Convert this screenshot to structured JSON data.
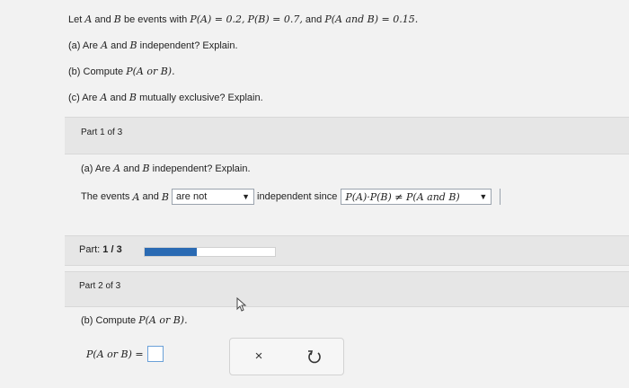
{
  "problem": {
    "intro": "Let",
    "A": "A",
    "and": "and",
    "B": "B",
    "be_events": "be events with",
    "pa": "P(A) = 0.2,",
    "pb": "P(B) = 0.7,",
    "and2": "and",
    "pab": "P(A and B) = 0.15.",
    "qa_prefix": "(a) Are",
    "qa_suffix": "independent? Explain.",
    "qb_prefix": "(b) Compute",
    "qb_expr": "P(A or B).",
    "qc_prefix": "(c) Are",
    "qc_suffix": "mutually exclusive? Explain."
  },
  "part1": {
    "title": "Part 1 of 3",
    "question_prefix": "(a) Are",
    "question_suffix": "independent? Explain.",
    "answer_prefix": "The events",
    "answer_and": "and",
    "select1_value": "are not",
    "answer_mid": "independent since",
    "select2_value": "P(A)·P(B) ≠ P(A and B)"
  },
  "progress": {
    "label": "Part:",
    "value": "1 / 3",
    "fraction": 0.4
  },
  "part2": {
    "title": "Part 2 of 3",
    "question_prefix": "(b) Compute",
    "question_expr": "P(A or B).",
    "answer_expr": "P(A or B) ="
  },
  "actions": {
    "clear_glyph": "×",
    "retry_icon": "undo-icon"
  }
}
